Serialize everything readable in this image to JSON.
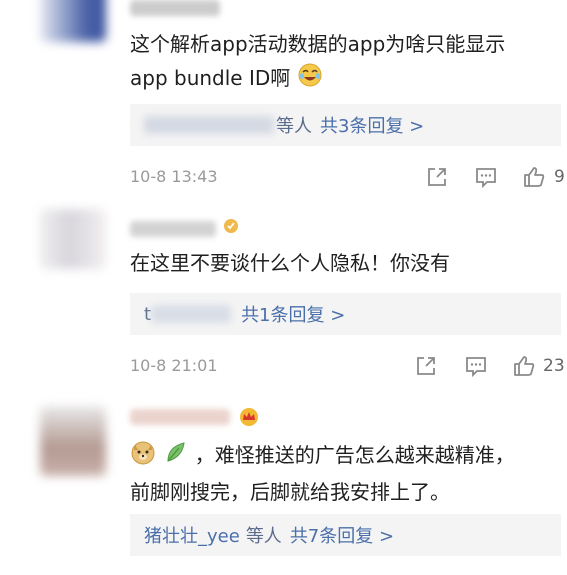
{
  "comments": [
    {
      "text_line1": "这个解析app活动数据的app为啥只能显示",
      "text_line2": "app bundle ID啊",
      "reply_suffix": "等人",
      "reply_more": "共3条回复 >",
      "date": "10-8 13:43",
      "likes": "9"
    },
    {
      "text_line1": "在这里不要谈什么个人隐私！你没有",
      "reply_prefix": "t",
      "reply_more": "共1条回复 >",
      "date": "10-8 21:01",
      "likes": "23"
    },
    {
      "text_line1": "，难怪推送的广告怎么越来越精准，",
      "text_line2": "前脚刚搜完，后脚就给我安排上了。",
      "reply_prefix": "猪壮壮_yee",
      "reply_suffix": "等人",
      "reply_more": "共7条回复 >"
    }
  ],
  "colors": {
    "link": "#4a6faa",
    "reply_bg": "#f4f4f4",
    "meta": "#9a9a9a"
  }
}
